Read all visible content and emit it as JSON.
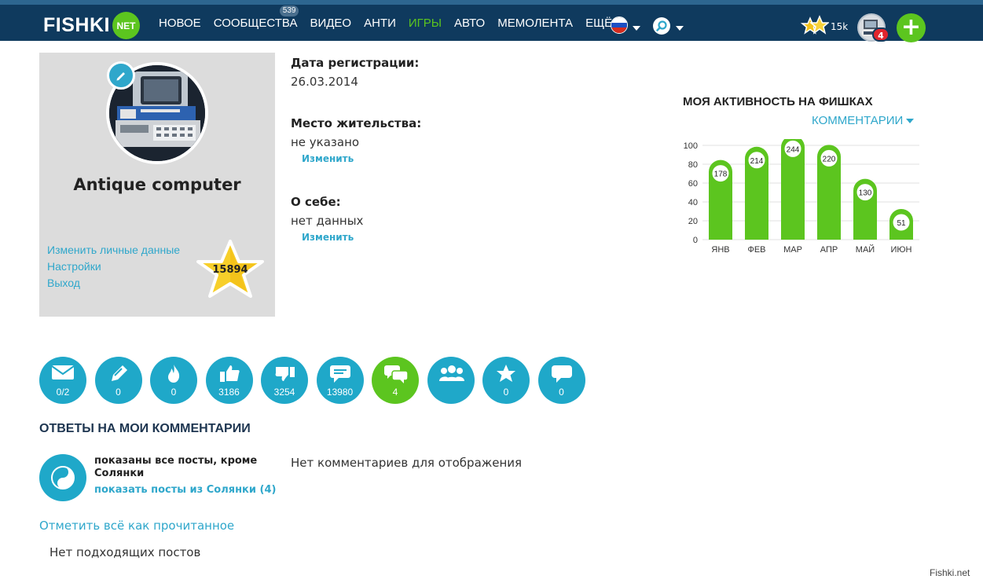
{
  "header": {
    "logo_text": "FISHKI",
    "logo_badge": "NET",
    "nav": [
      {
        "label": "НОВОЕ"
      },
      {
        "label": "СООБЩЕСТВА",
        "badge": "539"
      },
      {
        "label": "ВИДЕО"
      },
      {
        "label": "АНТИ"
      },
      {
        "label": "ИГРЫ",
        "active": true
      },
      {
        "label": "АВТО"
      },
      {
        "label": "МЕМОЛЕНТА"
      },
      {
        "label": "ЕЩЁ"
      }
    ],
    "rating": "15k",
    "notifications": "4",
    "add_label": "+"
  },
  "profile": {
    "name": "Antique computer",
    "links": [
      "Изменить личные данные",
      "Настройки",
      "Выход"
    ],
    "score": "15894"
  },
  "info": {
    "reg_label": "Дата регистрации:",
    "reg_value": "26.03.2014",
    "place_label": "Место жительства:",
    "place_value": "не указано",
    "place_edit": "Изменить",
    "about_label": "О себе:",
    "about_value": "нет данных",
    "about_edit": "Изменить"
  },
  "activity": {
    "title": "МОЯ АКТИВНОСТЬ НА ФИШКАХ",
    "selector": "КОММЕНТАРИИ"
  },
  "chart_data": {
    "type": "bar",
    "categories": [
      "ЯНВ",
      "ФЕВ",
      "МАР",
      "АПР",
      "МАЙ",
      "ИЮН"
    ],
    "values": [
      178,
      214,
      244,
      220,
      130,
      51
    ],
    "bar_levels": [
      72,
      86,
      98,
      88,
      52,
      20
    ],
    "yticks": [
      0,
      20,
      40,
      60,
      80,
      100
    ],
    "ylim": [
      0,
      100
    ],
    "bar_color": "#5cc51f",
    "grid": true
  },
  "stats": [
    {
      "icon": "mail-icon",
      "count": "0/2"
    },
    {
      "icon": "pencil-icon",
      "count": "0"
    },
    {
      "icon": "fire-icon",
      "count": "0"
    },
    {
      "icon": "thumbs-up-icon",
      "count": "3186"
    },
    {
      "icon": "thumbs-down-icon",
      "count": "3254"
    },
    {
      "icon": "comment-icon",
      "count": "13980"
    },
    {
      "icon": "comments-icon",
      "count": "4",
      "active": true
    },
    {
      "icon": "users-icon",
      "count": ""
    },
    {
      "icon": "star-icon",
      "count": "0"
    },
    {
      "icon": "chat-icon",
      "count": "0"
    }
  ],
  "replies": {
    "title": "ОТВЕТЫ НА МОИ КОММЕНТАРИИ",
    "filter_text": "показаны все посты, кроме Солянки",
    "filter_link": "показать посты из Солянки (4)",
    "empty": "Нет комментариев для отображения",
    "mark_read": "Отметить всё как прочитанное",
    "no_posts": "Нет подходящих постов"
  },
  "watermark": "Fishki.net",
  "colors": {
    "nav_bg": "#0f3a5e",
    "accent_blue": "#1fa8c9",
    "accent_green": "#5cc51f",
    "link": "#2fa7cb"
  }
}
